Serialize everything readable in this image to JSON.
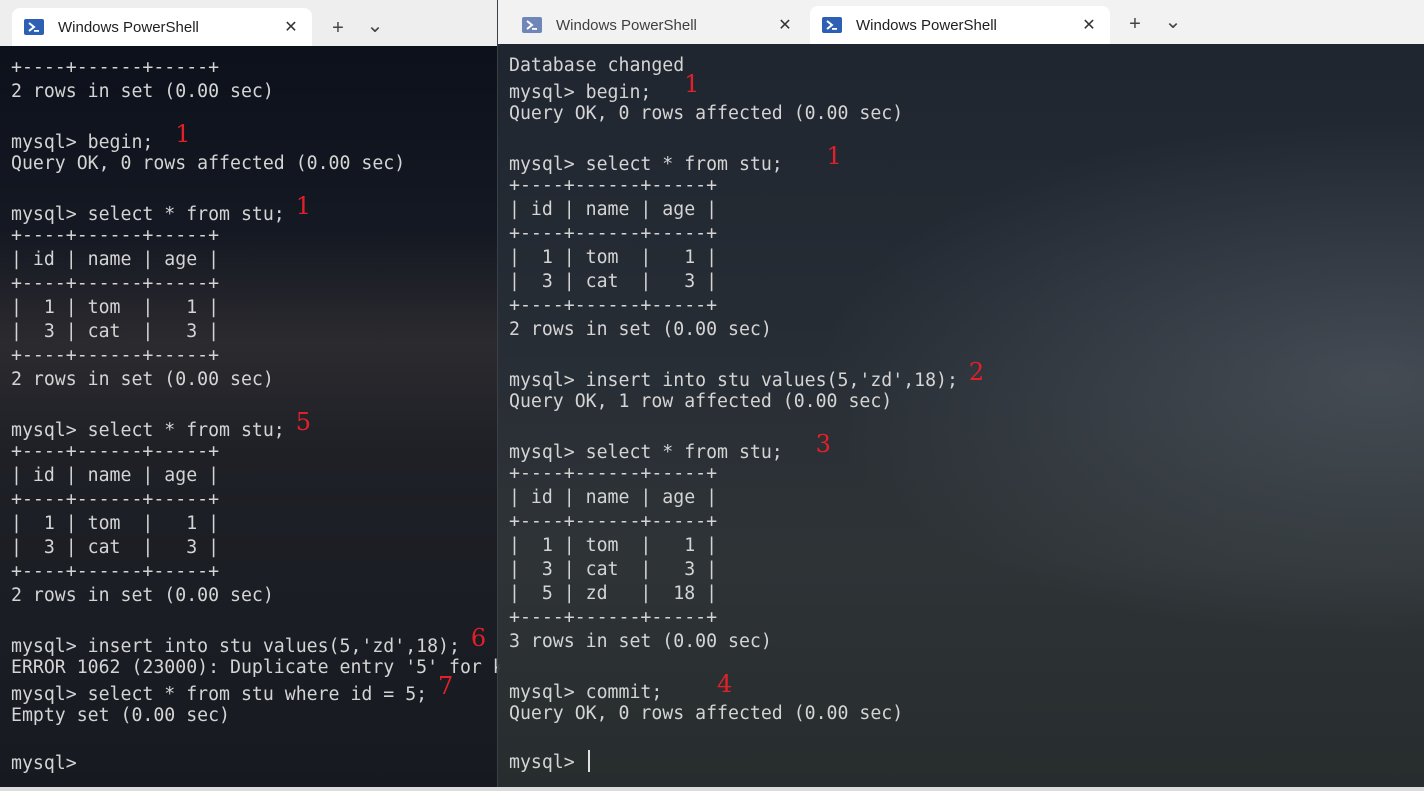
{
  "left_window": {
    "tab_title": "Windows PowerShell",
    "close_glyph": "✕",
    "new_tab_glyph": "+",
    "dropdown_glyph": "⌄",
    "lines": [
      {
        "text": "+----+------+-----+",
        "anno": ""
      },
      {
        "text": "2 rows in set (0.00 sec)",
        "anno": ""
      },
      {
        "text": "",
        "anno": ""
      },
      {
        "text": "mysql> begin;  ",
        "anno": "1"
      },
      {
        "text": "Query OK, 0 rows affected (0.00 sec)",
        "anno": ""
      },
      {
        "text": "",
        "anno": ""
      },
      {
        "text": "mysql> select * from stu; ",
        "anno": "1"
      },
      {
        "text": "+----+------+-----+",
        "anno": ""
      },
      {
        "text": "| id | name | age |",
        "anno": ""
      },
      {
        "text": "+----+------+-----+",
        "anno": ""
      },
      {
        "text": "|  1 | tom  |   1 |",
        "anno": ""
      },
      {
        "text": "|  3 | cat  |   3 |",
        "anno": ""
      },
      {
        "text": "+----+------+-----+",
        "anno": ""
      },
      {
        "text": "2 rows in set (0.00 sec)",
        "anno": ""
      },
      {
        "text": "",
        "anno": ""
      },
      {
        "text": "mysql> select * from stu; ",
        "anno": "5"
      },
      {
        "text": "+----+------+-----+",
        "anno": ""
      },
      {
        "text": "| id | name | age |",
        "anno": ""
      },
      {
        "text": "+----+------+-----+",
        "anno": ""
      },
      {
        "text": "|  1 | tom  |   1 |",
        "anno": ""
      },
      {
        "text": "|  3 | cat  |   3 |",
        "anno": ""
      },
      {
        "text": "+----+------+-----+",
        "anno": ""
      },
      {
        "text": "2 rows in set (0.00 sec)",
        "anno": ""
      },
      {
        "text": "",
        "anno": ""
      },
      {
        "text": "mysql> insert into stu values(5,'zd',18); ",
        "anno": "6"
      },
      {
        "text": "ERROR 1062 (23000): Duplicate entry '5' for k",
        "anno": ""
      },
      {
        "text": "mysql> select * from stu where id = 5; ",
        "anno": "7"
      },
      {
        "text": "Empty set (0.00 sec)",
        "anno": ""
      },
      {
        "text": "",
        "anno": ""
      },
      {
        "text": "mysql> ",
        "anno": ""
      }
    ]
  },
  "right_window": {
    "tabs": [
      {
        "title": "Windows PowerShell",
        "active": false
      },
      {
        "title": "Windows PowerShell",
        "active": true
      }
    ],
    "close_glyph": "✕",
    "new_tab_glyph": "+",
    "dropdown_glyph": "⌄",
    "lines": [
      {
        "text": "Database changed",
        "anno": ""
      },
      {
        "text": "mysql> begin;   ",
        "anno": "1"
      },
      {
        "text": "Query OK, 0 rows affected (0.00 sec)",
        "anno": ""
      },
      {
        "text": "",
        "anno": ""
      },
      {
        "text": "mysql> select * from stu;    ",
        "anno": "1"
      },
      {
        "text": "+----+------+-----+",
        "anno": ""
      },
      {
        "text": "| id | name | age |",
        "anno": ""
      },
      {
        "text": "+----+------+-----+",
        "anno": ""
      },
      {
        "text": "|  1 | tom  |   1 |",
        "anno": ""
      },
      {
        "text": "|  3 | cat  |   3 |",
        "anno": ""
      },
      {
        "text": "+----+------+-----+",
        "anno": ""
      },
      {
        "text": "2 rows in set (0.00 sec)",
        "anno": ""
      },
      {
        "text": "",
        "anno": ""
      },
      {
        "text": "mysql> insert into stu values(5,'zd',18); ",
        "anno": "2"
      },
      {
        "text": "Query OK, 1 row affected (0.00 sec)",
        "anno": ""
      },
      {
        "text": "",
        "anno": ""
      },
      {
        "text": "mysql> select * from stu;   ",
        "anno": "3"
      },
      {
        "text": "+----+------+-----+",
        "anno": ""
      },
      {
        "text": "| id | name | age |",
        "anno": ""
      },
      {
        "text": "+----+------+-----+",
        "anno": ""
      },
      {
        "text": "|  1 | tom  |   1 |",
        "anno": ""
      },
      {
        "text": "|  3 | cat  |   3 |",
        "anno": ""
      },
      {
        "text": "|  5 | zd   |  18 |",
        "anno": ""
      },
      {
        "text": "+----+------+-----+",
        "anno": ""
      },
      {
        "text": "3 rows in set (0.00 sec)",
        "anno": ""
      },
      {
        "text": "",
        "anno": ""
      },
      {
        "text": "mysql> commit;     ",
        "anno": "4"
      },
      {
        "text": "Query OK, 0 rows affected (0.00 sec)",
        "anno": ""
      },
      {
        "text": "",
        "anno": ""
      },
      {
        "text": "mysql> ",
        "anno": "",
        "cursor": true
      }
    ]
  },
  "colors": {
    "annotation": "#e3202a",
    "terminal_text": "#d4d4d4",
    "powershell_icon": "#2d5fb5"
  },
  "icons": {
    "tab_icon": "powershell-icon",
    "close": "close-icon",
    "new_tab": "plus-icon",
    "dropdown": "chevron-down-icon"
  }
}
